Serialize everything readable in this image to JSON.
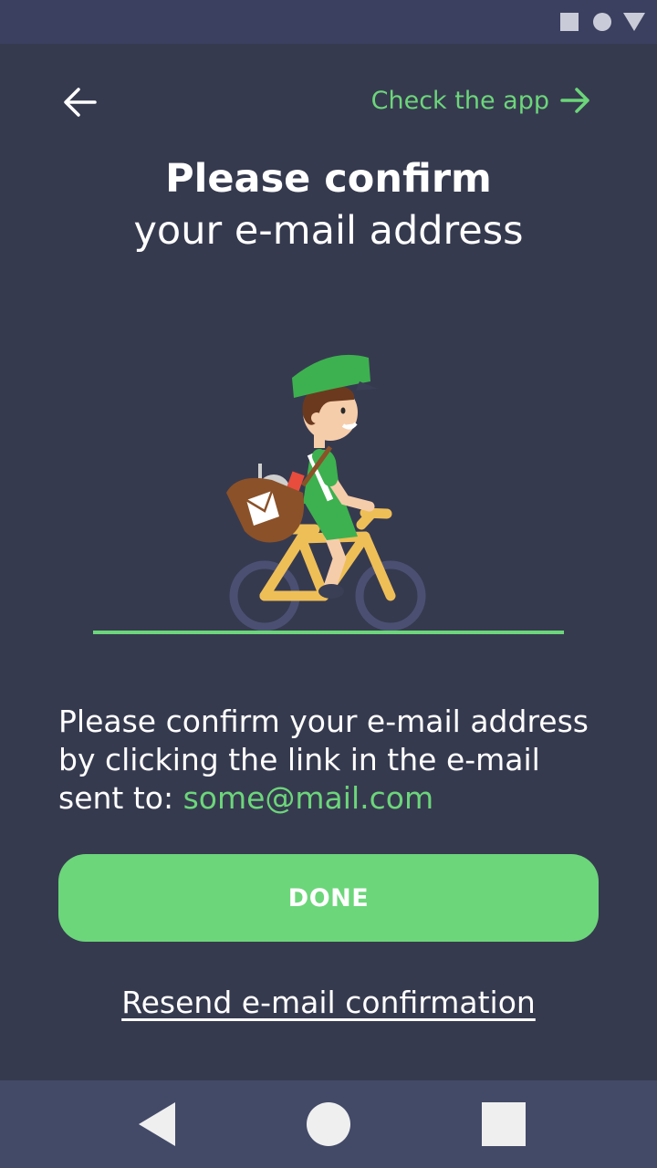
{
  "header": {
    "check_app_label": "Check the app"
  },
  "title": {
    "line1": "Please confirm",
    "line2": "your e-mail address"
  },
  "message": {
    "text": "Please confirm your e-mail address by clicking the link in the e-mail sent to: ",
    "email": "some@mail.com"
  },
  "actions": {
    "done_label": "DONE",
    "resend_label": "Resend e-mail confirmation"
  },
  "colors": {
    "background": "#363a4f",
    "accent": "#6cd67a",
    "status_bar": "#3b4060",
    "nav_bar": "#434a68"
  },
  "icons": {
    "back": "arrow-left-icon",
    "forward": "arrow-right-icon",
    "illustration": "cyclist-mail-courier"
  }
}
